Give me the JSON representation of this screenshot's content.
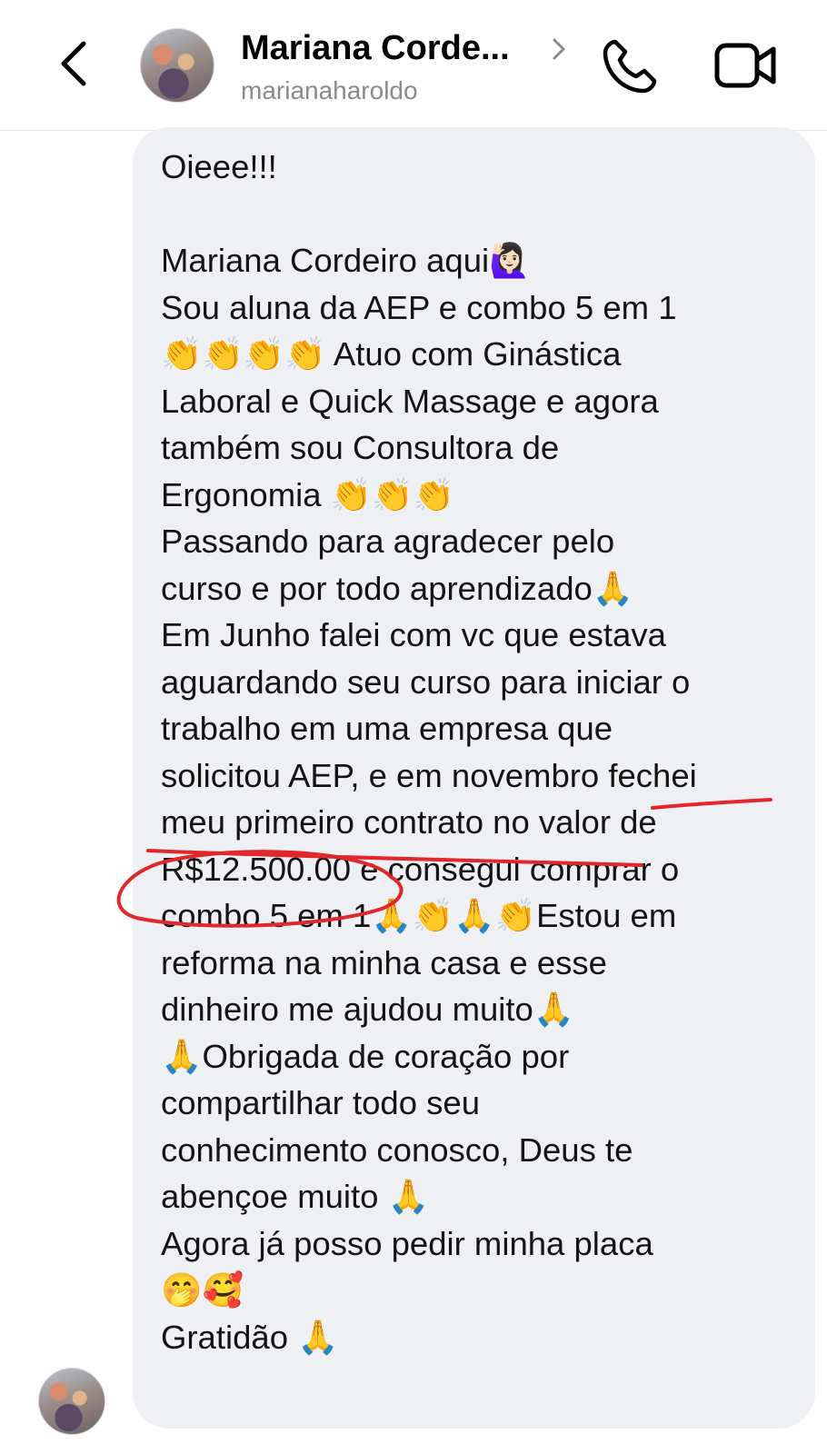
{
  "header": {
    "back_icon": "chevron-left-icon",
    "contact_name": "Mariana Corde...",
    "username": "marianaharoldo",
    "call_icon": "phone-icon",
    "video_icon": "video-camera-icon"
  },
  "message": {
    "lines": [
      "Oieee!!!",
      "",
      "Mariana Cordeiro aqui🙋🏻‍♀️",
      "Sou aluna da AEP e combo 5 em 1",
      "👏👏👏👏 Atuo com Ginástica",
      "Laboral e Quick Massage e agora",
      "também sou Consultora de",
      "Ergonomia 👏👏👏",
      "Passando para agradecer pelo",
      "curso e por todo aprendizado🙏",
      "Em Junho falei com vc que estava",
      "aguardando seu curso para iniciar o",
      "trabalho em uma empresa que",
      "solicitou AEP, e em novembro fechei",
      "meu primeiro contrato no valor de",
      "R$12.500.00 e consegui comprar o",
      "combo 5 em 1🙏👏🙏👏Estou em",
      "reforma na minha casa e esse",
      "dinheiro me ajudou muito🙏",
      "🙏Obrigada de coração por",
      "compartilhar todo seu",
      "conhecimento conosco, Deus te",
      "abençoe muito 🙏",
      "Agora já posso pedir minha placa",
      "🤭🥰",
      "Gratidão 🙏"
    ]
  },
  "colors": {
    "bubble": "#eff0f3",
    "annotation": "#e0272b",
    "secondary_text": "#8a8a8a"
  }
}
